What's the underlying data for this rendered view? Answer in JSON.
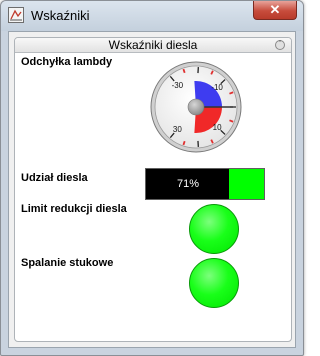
{
  "window": {
    "title": "Wskaźniki",
    "close_glyph": "✕",
    "icon": "gauge-app-icon"
  },
  "panel": {
    "title": "Wskaźniki diesla",
    "collapse_glyph": "ˆ"
  },
  "indicators": {
    "lambda_label": "Odchyłka lambdy",
    "diesel_share_label": "Udział diesla",
    "diesel_share_value": 0.71,
    "diesel_share_text": "71%",
    "reduction_limit_label": "Limit redukcji diesla",
    "knock_label": "Spalanie stukowe"
  },
  "gauge": {
    "min": -30,
    "max": 30,
    "needle_value": 0,
    "tick_labels": [
      "-30",
      "-10",
      "10",
      "30"
    ],
    "colors": {
      "negative": "#3e3cf0",
      "positive": "#f02828",
      "minor_ticks": "#e03030"
    }
  },
  "led_colors": {
    "reduction_limit": "#00ff00",
    "knock": "#00ff00"
  }
}
